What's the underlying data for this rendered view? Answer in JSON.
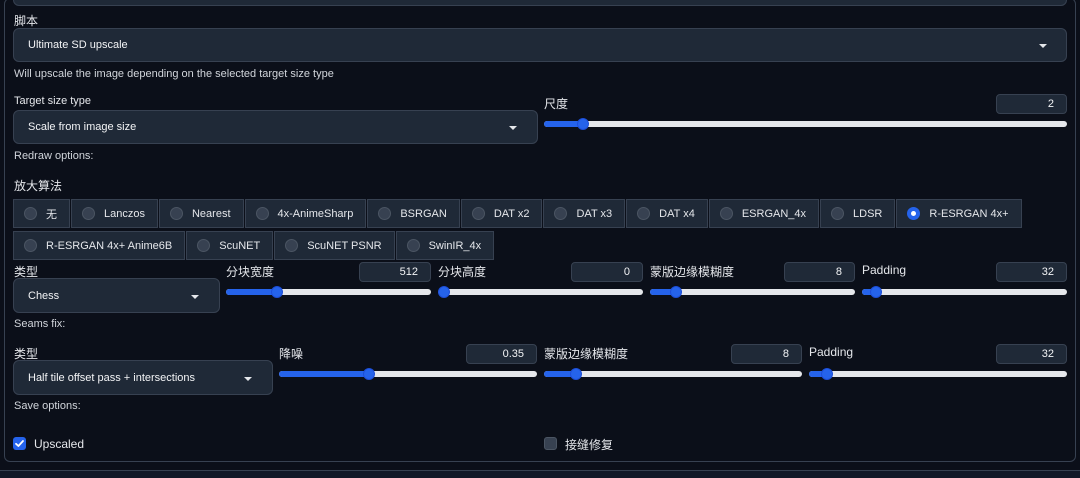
{
  "script": {
    "label": "脚本",
    "selected": "Ultimate SD upscale",
    "description": "Will upscale the image depending on the selected target size type"
  },
  "target_size": {
    "label": "Target size type",
    "selected": "Scale from image size"
  },
  "scale": {
    "label": "尺度",
    "value": "2",
    "fraction": 0.075
  },
  "redraw_options_label": "Redraw options:",
  "upscaler": {
    "label": "放大算法",
    "options": [
      "无",
      "Lanczos",
      "Nearest",
      "4x-AnimeSharp",
      "BSRGAN",
      "DAT x2",
      "DAT x3",
      "DAT x4",
      "ESRGAN_4x",
      "LDSR",
      "R-ESRGAN 4x+",
      "R-ESRGAN 4x+ Anime6B",
      "ScuNET",
      "ScuNET PSNR",
      "SwinIR_4x"
    ],
    "selected": "R-ESRGAN 4x+"
  },
  "redraw": {
    "type_label": "类型",
    "type_selected": "Chess",
    "tile_width": {
      "label": "分块宽度",
      "value": "512",
      "fraction": 0.25
    },
    "tile_height": {
      "label": "分块高度",
      "value": "0",
      "fraction": 0.0
    },
    "mask_blur": {
      "label": "蒙版边缘模糊度",
      "value": "8",
      "fraction": 0.125
    },
    "padding": {
      "label": "Padding",
      "value": "32",
      "fraction": 0.07
    }
  },
  "seams_fix_label": "Seams fix:",
  "seams": {
    "type_label": "类型",
    "type_selected": "Half tile offset pass + intersections",
    "denoise": {
      "label": "降噪",
      "value": "0.35",
      "fraction": 0.35
    },
    "mask_blur": {
      "label": "蒙版边缘模糊度",
      "value": "8",
      "fraction": 0.125
    },
    "padding": {
      "label": "Padding",
      "value": "32",
      "fraction": 0.07
    }
  },
  "save_options_label": "Save options:",
  "save": {
    "upscaled": {
      "label": "Upscaled",
      "checked": true
    },
    "seams_fix": {
      "label": "接缝修复",
      "checked": false
    }
  }
}
